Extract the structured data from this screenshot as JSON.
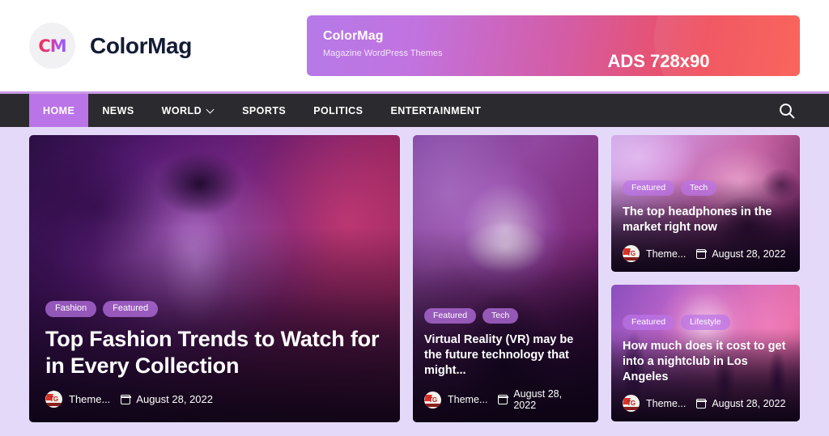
{
  "header": {
    "brand_initials": "CM",
    "brand_name": "ColorMag",
    "ad": {
      "title": "ColorMag",
      "subtitle": "Magazine WordPress Themes",
      "size_label": "ADS 728x90"
    }
  },
  "nav": {
    "items": [
      {
        "label": "HOME",
        "active": true,
        "has_dropdown": false
      },
      {
        "label": "NEWS",
        "active": false,
        "has_dropdown": false
      },
      {
        "label": "WORLD",
        "active": false,
        "has_dropdown": true
      },
      {
        "label": "SPORTS",
        "active": false,
        "has_dropdown": false
      },
      {
        "label": "POLITICS",
        "active": false,
        "has_dropdown": false
      },
      {
        "label": "ENTERTAINMENT",
        "active": false,
        "has_dropdown": false
      }
    ],
    "search_icon": "search-icon"
  },
  "cards": {
    "hero": {
      "badges": [
        "Fashion",
        "Featured"
      ],
      "title": "Top Fashion Trends to Watch for in Every Collection",
      "author": "Theme...",
      "author_avatar": "tg-avatar",
      "date": "August 28, 2022",
      "date_icon": "calendar-icon",
      "image": "fashion-model-in-hat"
    },
    "middle": {
      "badges": [
        "Featured",
        "Tech"
      ],
      "title": "Virtual Reality (VR) may be the future technology that might...",
      "author": "Theme...",
      "author_avatar": "tg-avatar",
      "date": "August 28, 2022",
      "date_icon": "calendar-icon",
      "image": "woman-wearing-vr-headset"
    },
    "top_right": {
      "badges": [
        "Featured",
        "Tech"
      ],
      "title": "The top headphones in the market right now",
      "author": "Theme...",
      "author_avatar": "tg-avatar",
      "date": "August 28, 2022",
      "date_icon": "calendar-icon",
      "image": "child-wearing-headphones"
    },
    "bottom_right": {
      "badges": [
        "Featured",
        "Lifestyle"
      ],
      "title": "How much does it cost to get into a nightclub in Los Angeles",
      "author": "Theme...",
      "author_avatar": "tg-avatar",
      "date": "August 28, 2022",
      "date_icon": "calendar-icon",
      "image": "nightclub-crowd-silhouettes"
    }
  },
  "colors": {
    "nav_background": "#2b2a2e",
    "accent_purple": "#bb74e8",
    "page_background": "#e4d9f9",
    "brand_text": "#141b34"
  }
}
